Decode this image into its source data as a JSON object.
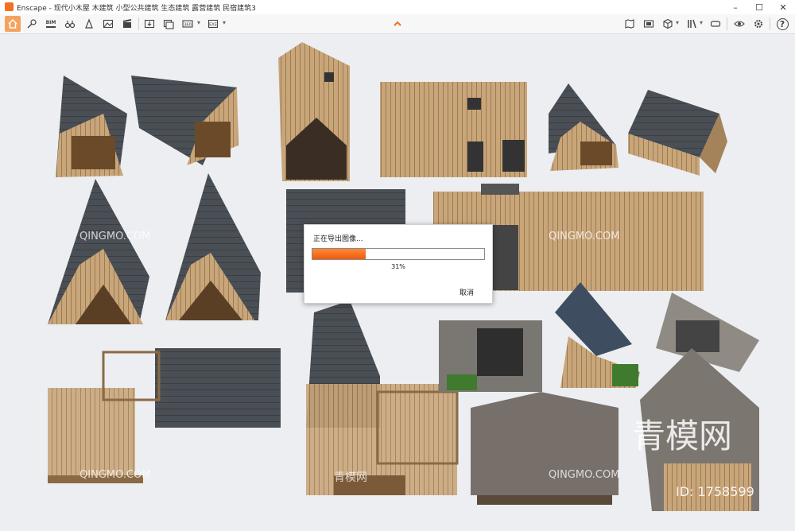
{
  "window": {
    "title": "Enscape - 现代小木屋 木建筑 小型公共建筑 生态建筑 露营建筑 民宿建筑3",
    "accent_color": "#f37021",
    "controls": [
      "minimize-icon",
      "maximize-icon",
      "close-icon"
    ]
  },
  "toolbar": {
    "left_icons": [
      "home-icon",
      "navigation-icon",
      "bim-icon",
      "binoculars-icon",
      "asset-library-icon",
      "mountain-icon",
      "clapper-icon",
      "screenshot-export-icon",
      "batch-render-icon",
      "panorama-export-icon",
      "exe-export-icon"
    ],
    "right_icons": [
      "map-icon",
      "views-icon",
      "cube-icon",
      "library-books-icon",
      "vr-headset-icon",
      "visual-settings-icon",
      "settings-icon",
      "help-icon"
    ],
    "bim_label": "BIM",
    "help_label": "?"
  },
  "export_dialog": {
    "title": "正在导出图像...",
    "progress": 0.31,
    "percent_label": "31%",
    "cancel_label": "取消",
    "progress_color": "#f26a12"
  },
  "watermarks": {
    "site": "QINGMO.COM",
    "logo_text": "青模网",
    "id_label": "ID: 1758599"
  },
  "colors": {
    "roof_dark": "#4a4f55",
    "wood_light": "#c9a67a",
    "wood_dark": "#8a6a45",
    "background": "#eceef1"
  }
}
